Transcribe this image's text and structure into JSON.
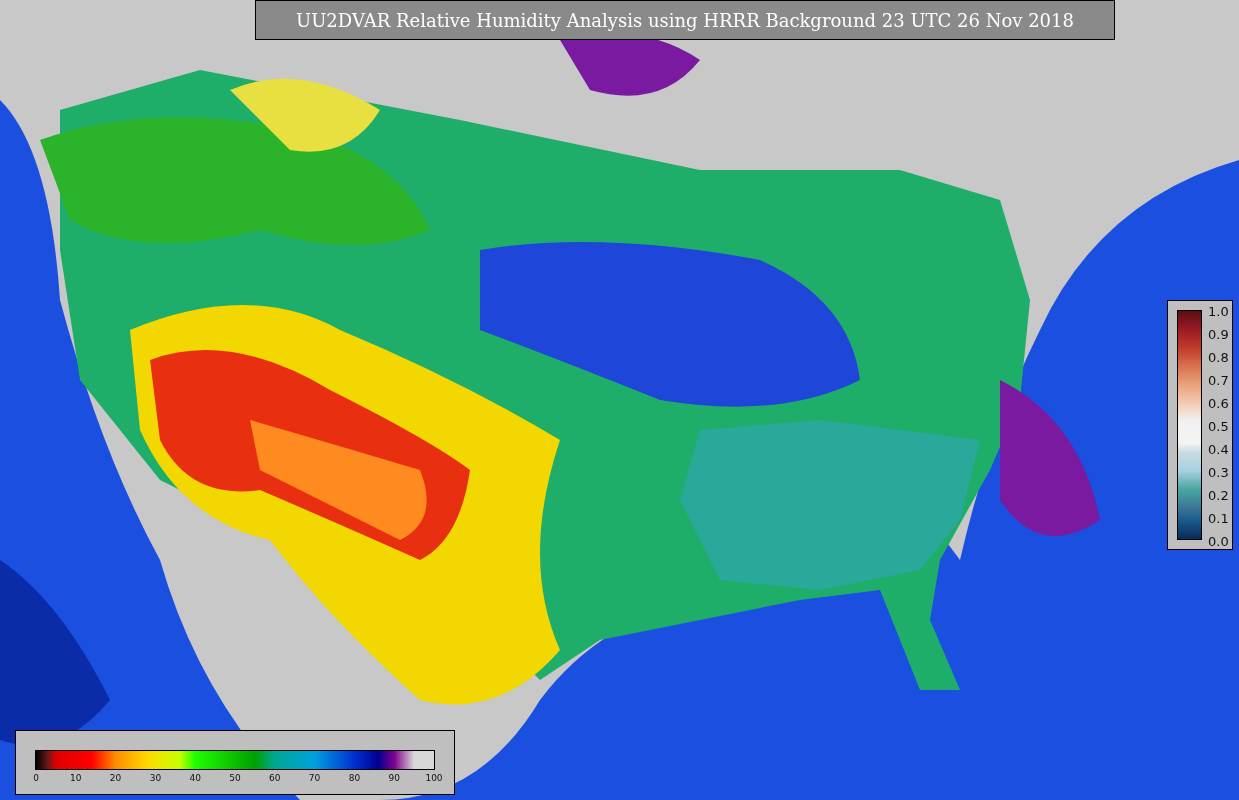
{
  "title": "UU2DVAR Relative Humidity Analysis using HRRR Background 23 UTC 26 Nov 2018",
  "humidity_legend": {
    "ticks": [
      "0",
      "10",
      "20",
      "30",
      "40",
      "50",
      "60",
      "70",
      "80",
      "90",
      "100"
    ]
  },
  "scale_legend": {
    "ticks": [
      "1.0",
      "0.9",
      "0.8",
      "0.7",
      "0.6",
      "0.5",
      "0.4",
      "0.3",
      "0.2",
      "0.1",
      "0.0"
    ]
  }
}
